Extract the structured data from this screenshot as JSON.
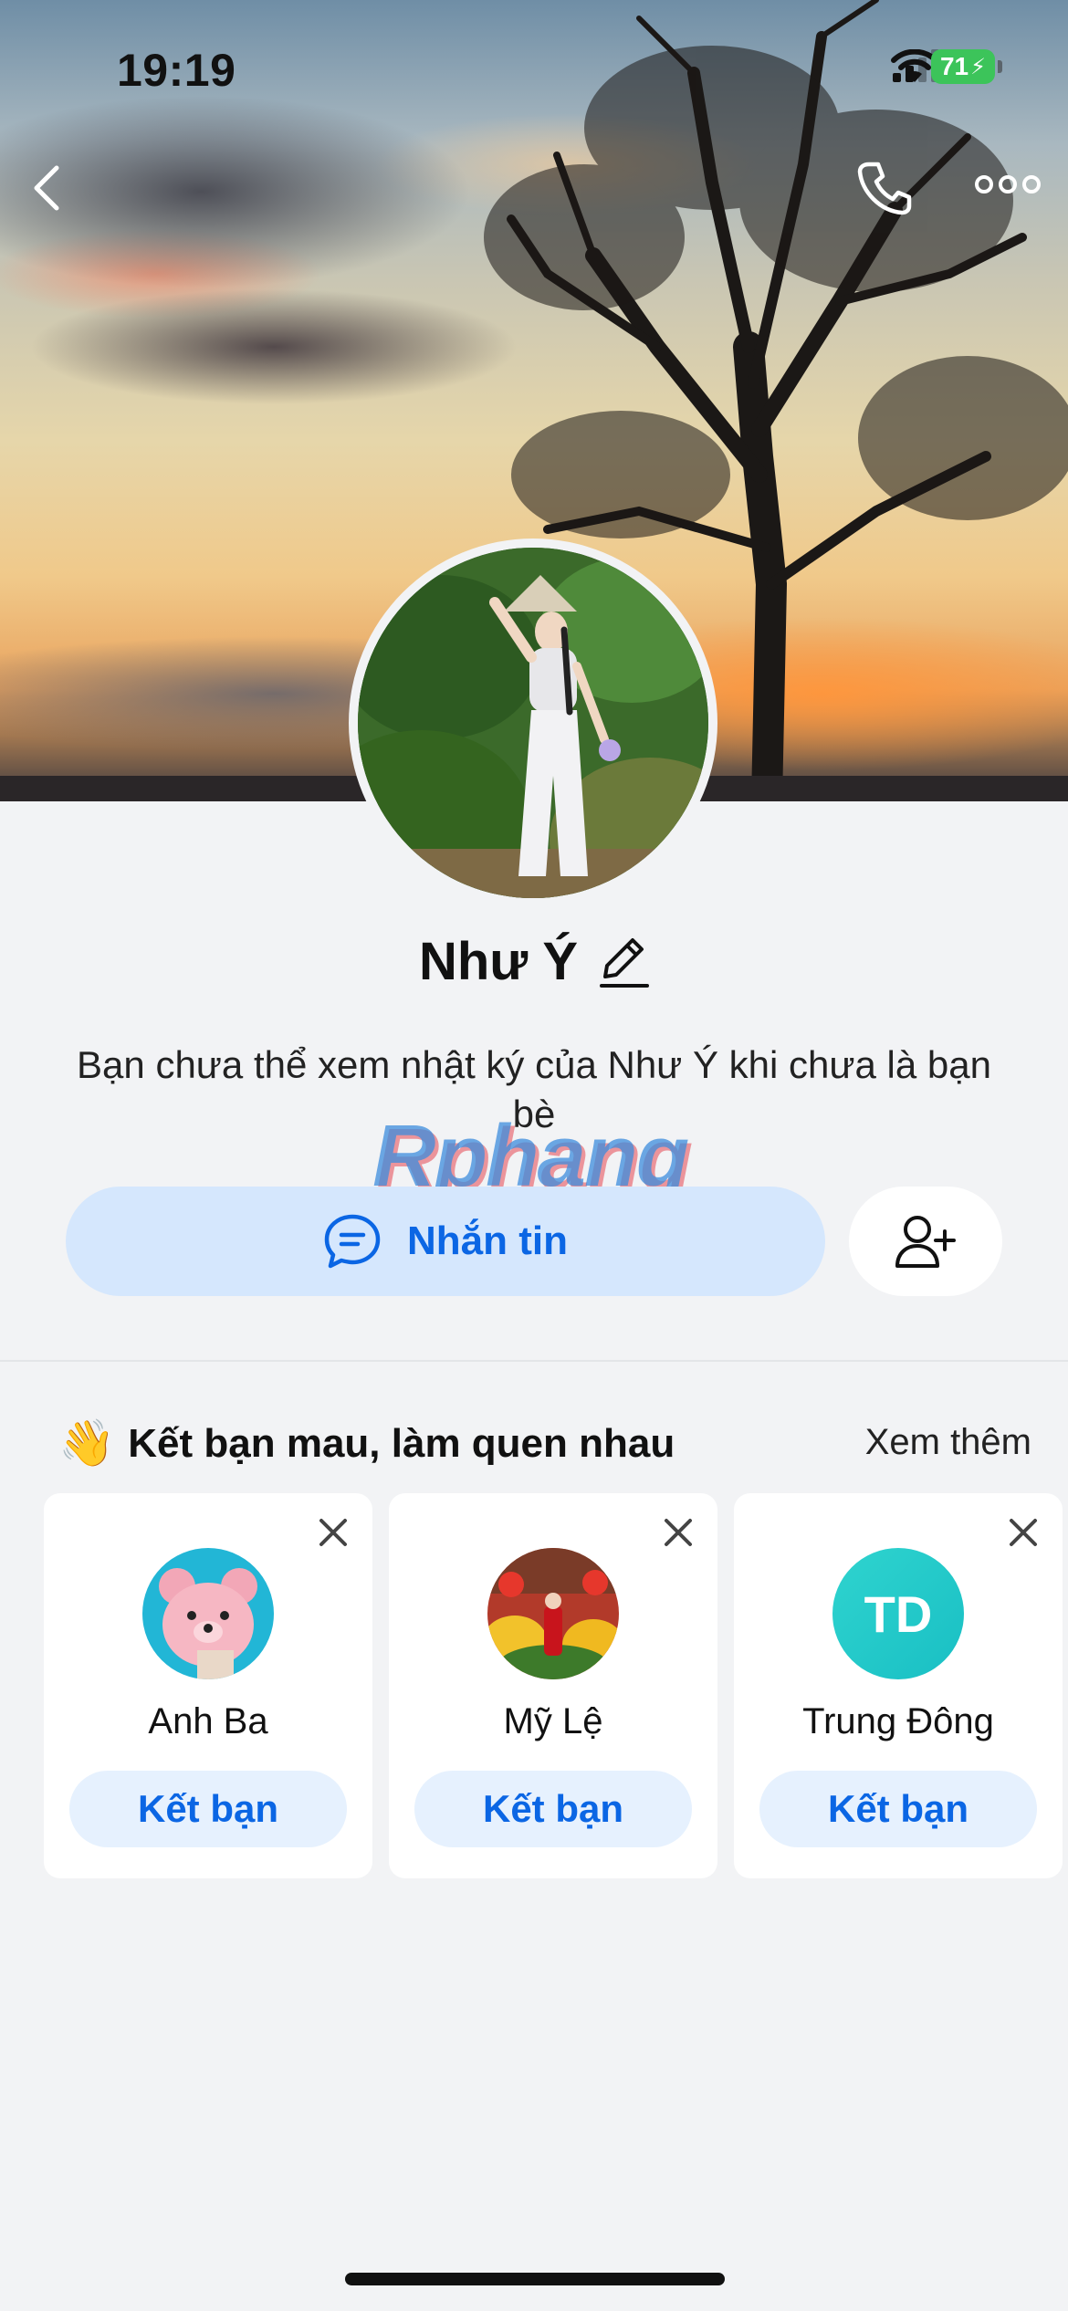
{
  "status_bar": {
    "time": "19:19",
    "battery": "71"
  },
  "profile": {
    "name": "Như Ý",
    "notice": "Bạn chưa thể xem nhật ký của Như Ý khi chưa là bạn bè",
    "message_button": "Nhắn tin"
  },
  "watermark": "Rphang",
  "suggestions": {
    "emoji": "👋",
    "title": "Kết bạn mau, làm quen nhau",
    "see_more": "Xem thêm",
    "items": [
      {
        "name": "Anh Ba",
        "action": "Kết bạn"
      },
      {
        "name": "Mỹ Lệ",
        "action": "Kết bạn"
      },
      {
        "name": "Trung Đông",
        "initials": "TD",
        "action": "Kết bạn"
      }
    ]
  },
  "colors": {
    "accent": "#0b66e4",
    "button_bg": "#d5e7fd",
    "battery": "#3cc45a"
  }
}
